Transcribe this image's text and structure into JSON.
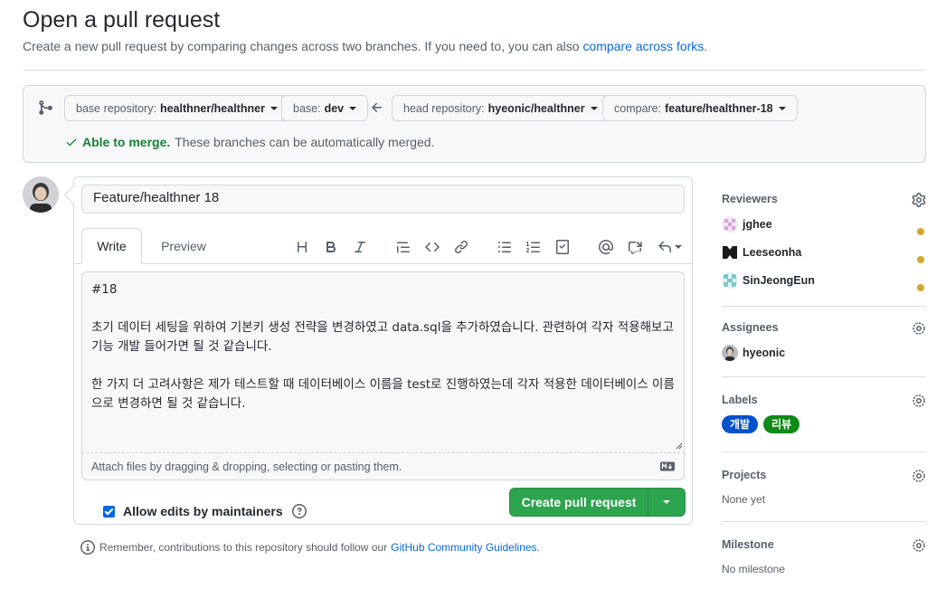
{
  "page": {
    "title": "Open a pull request",
    "subtitle": "Create a new pull request by comparing changes across two branches. If you need to, you can also",
    "subtitle_link": "compare across forks",
    "subtitle_end": "."
  },
  "range": {
    "base_repo_label": "base repository:",
    "base_repo_value": "healthner/healthner",
    "base_label": "base:",
    "base_value": "dev",
    "head_repo_label": "head repository:",
    "head_repo_value": "hyeonic/healthner",
    "compare_label": "compare:",
    "compare_value": "feature/healthner-18",
    "merge_ok": "Able to merge.",
    "merge_text": "These branches can be automatically merged."
  },
  "form": {
    "title_value": "Feature/healthner 18",
    "tab_write": "Write",
    "tab_preview": "Preview",
    "body": "#18\n\n초기 데이터 세팅을 위하여 기본키 생성 전략을 변경하였고 data.sql을 추가하였습니다. 관련하여 각자 적용해보고 기능 개발 들어가면 될 것 같습니다.\n\n한 가지 더 고려사항은 제가 테스트할 때 데이터베이스 이름을 test로 진행하였는데 각자 적용한 데이터베이스 이름으로 변경하면 될 것 같습니다.",
    "attach_hint": "Attach files by dragging & dropping, selecting or pasting them.",
    "allow_edits": "Allow edits by maintainers",
    "create_button": "Create pull request"
  },
  "footer": {
    "remember": "Remember, contributions to this repository should follow our",
    "guidelines_link": "GitHub Community Guidelines",
    "end": "."
  },
  "sidebar": {
    "reviewers_title": "Reviewers",
    "reviewers": [
      "jghee",
      "Leeseonha",
      "SinJeongEun"
    ],
    "assignees_title": "Assignees",
    "assignees": [
      "hyeonic"
    ],
    "labels_title": "Labels",
    "labels": [
      {
        "name": "개발",
        "color": "#0052cc"
      },
      {
        "name": "리뷰",
        "color": "#0e8a16"
      }
    ],
    "projects_title": "Projects",
    "projects_value": "None yet",
    "milestone_title": "Milestone",
    "milestone_value": "No milestone"
  },
  "colors": {
    "accent": "#0969da",
    "success": "#2da44e",
    "pending_dot": "#d4a72c"
  }
}
